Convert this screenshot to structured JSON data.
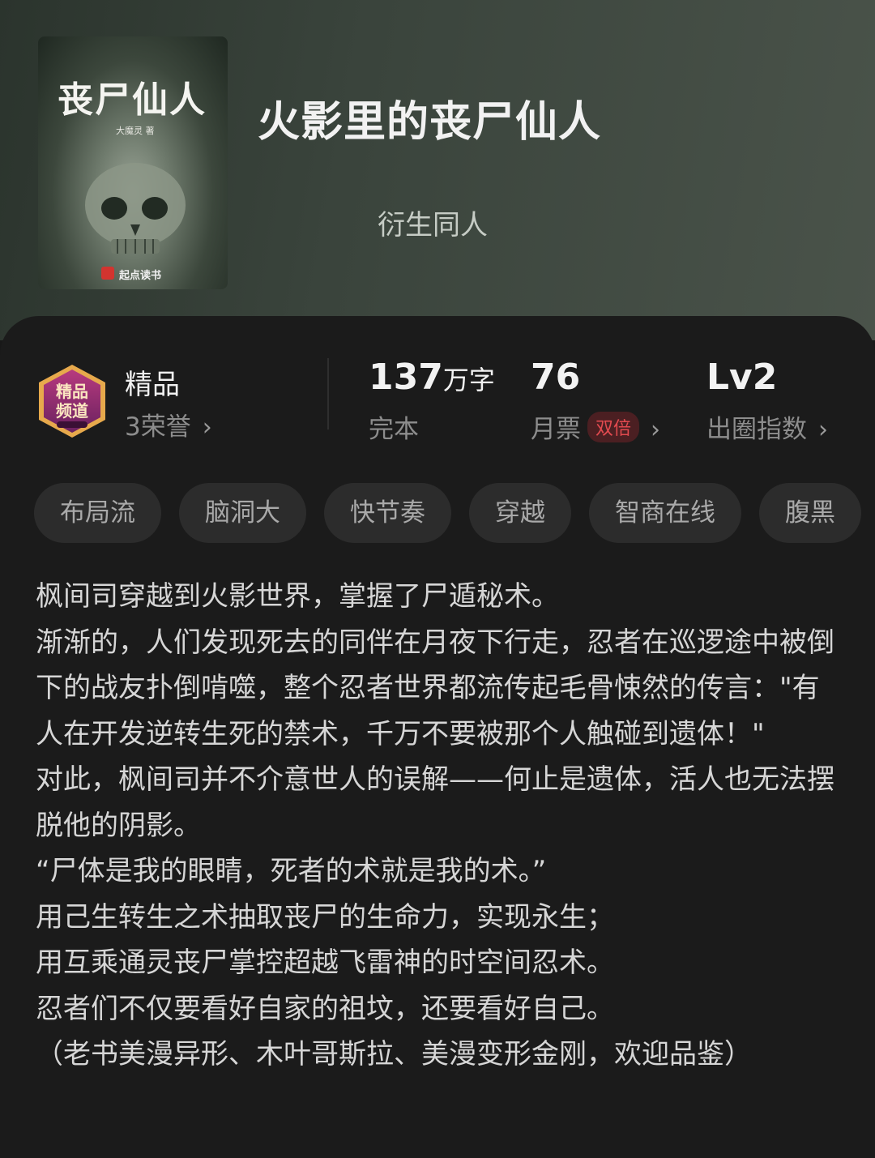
{
  "book": {
    "title": "火影里的丧尸仙人",
    "category": "衍生同人",
    "cover": {
      "title": "丧尸仙人",
      "author": "大魔灵 著",
      "publisher": "起点读书"
    }
  },
  "honor": {
    "name": "精品",
    "count": "3荣誉",
    "badge_text": "精品频道"
  },
  "stats": {
    "words_value": "137",
    "words_unit": "万字",
    "status": "完本",
    "tickets_value": "76",
    "tickets_label": "月票",
    "tickets_badge": "双倍",
    "level_value": "Lv2",
    "level_label": "出圈指数"
  },
  "tags": [
    "布局流",
    "脑洞大",
    "快节奏",
    "穿越",
    "智商在线",
    "腹黑"
  ],
  "description": [
    "枫间司穿越到火影世界，掌握了尸遁秘术。",
    "渐渐的，人们发现死去的同伴在月夜下行走，忍者在巡逻途中被倒下的战友扑倒啃噬，整个忍者世界都流传起毛骨悚然的传言：\"有人在开发逆转生死的禁术，千万不要被那个人触碰到遗体！\"",
    "对此，枫间司并不介意世人的误解——何止是遗体，活人也无法摆脱他的阴影。",
    "“尸体是我的眼睛，死者的术就是我的术。”",
    "用己生转生之术抽取丧尸的生命力，实现永生；",
    "用互乘通灵丧尸掌控超越飞雷神的时空间忍术。",
    "忍者们不仅要看好自家的祖坟，还要看好自己。",
    "（老书美漫异形、木叶哥斯拉、美漫变形金刚，欢迎品鉴）"
  ],
  "colors": {
    "accent_red": "#e24a4f",
    "badge_purple": "#7a2a6b"
  }
}
